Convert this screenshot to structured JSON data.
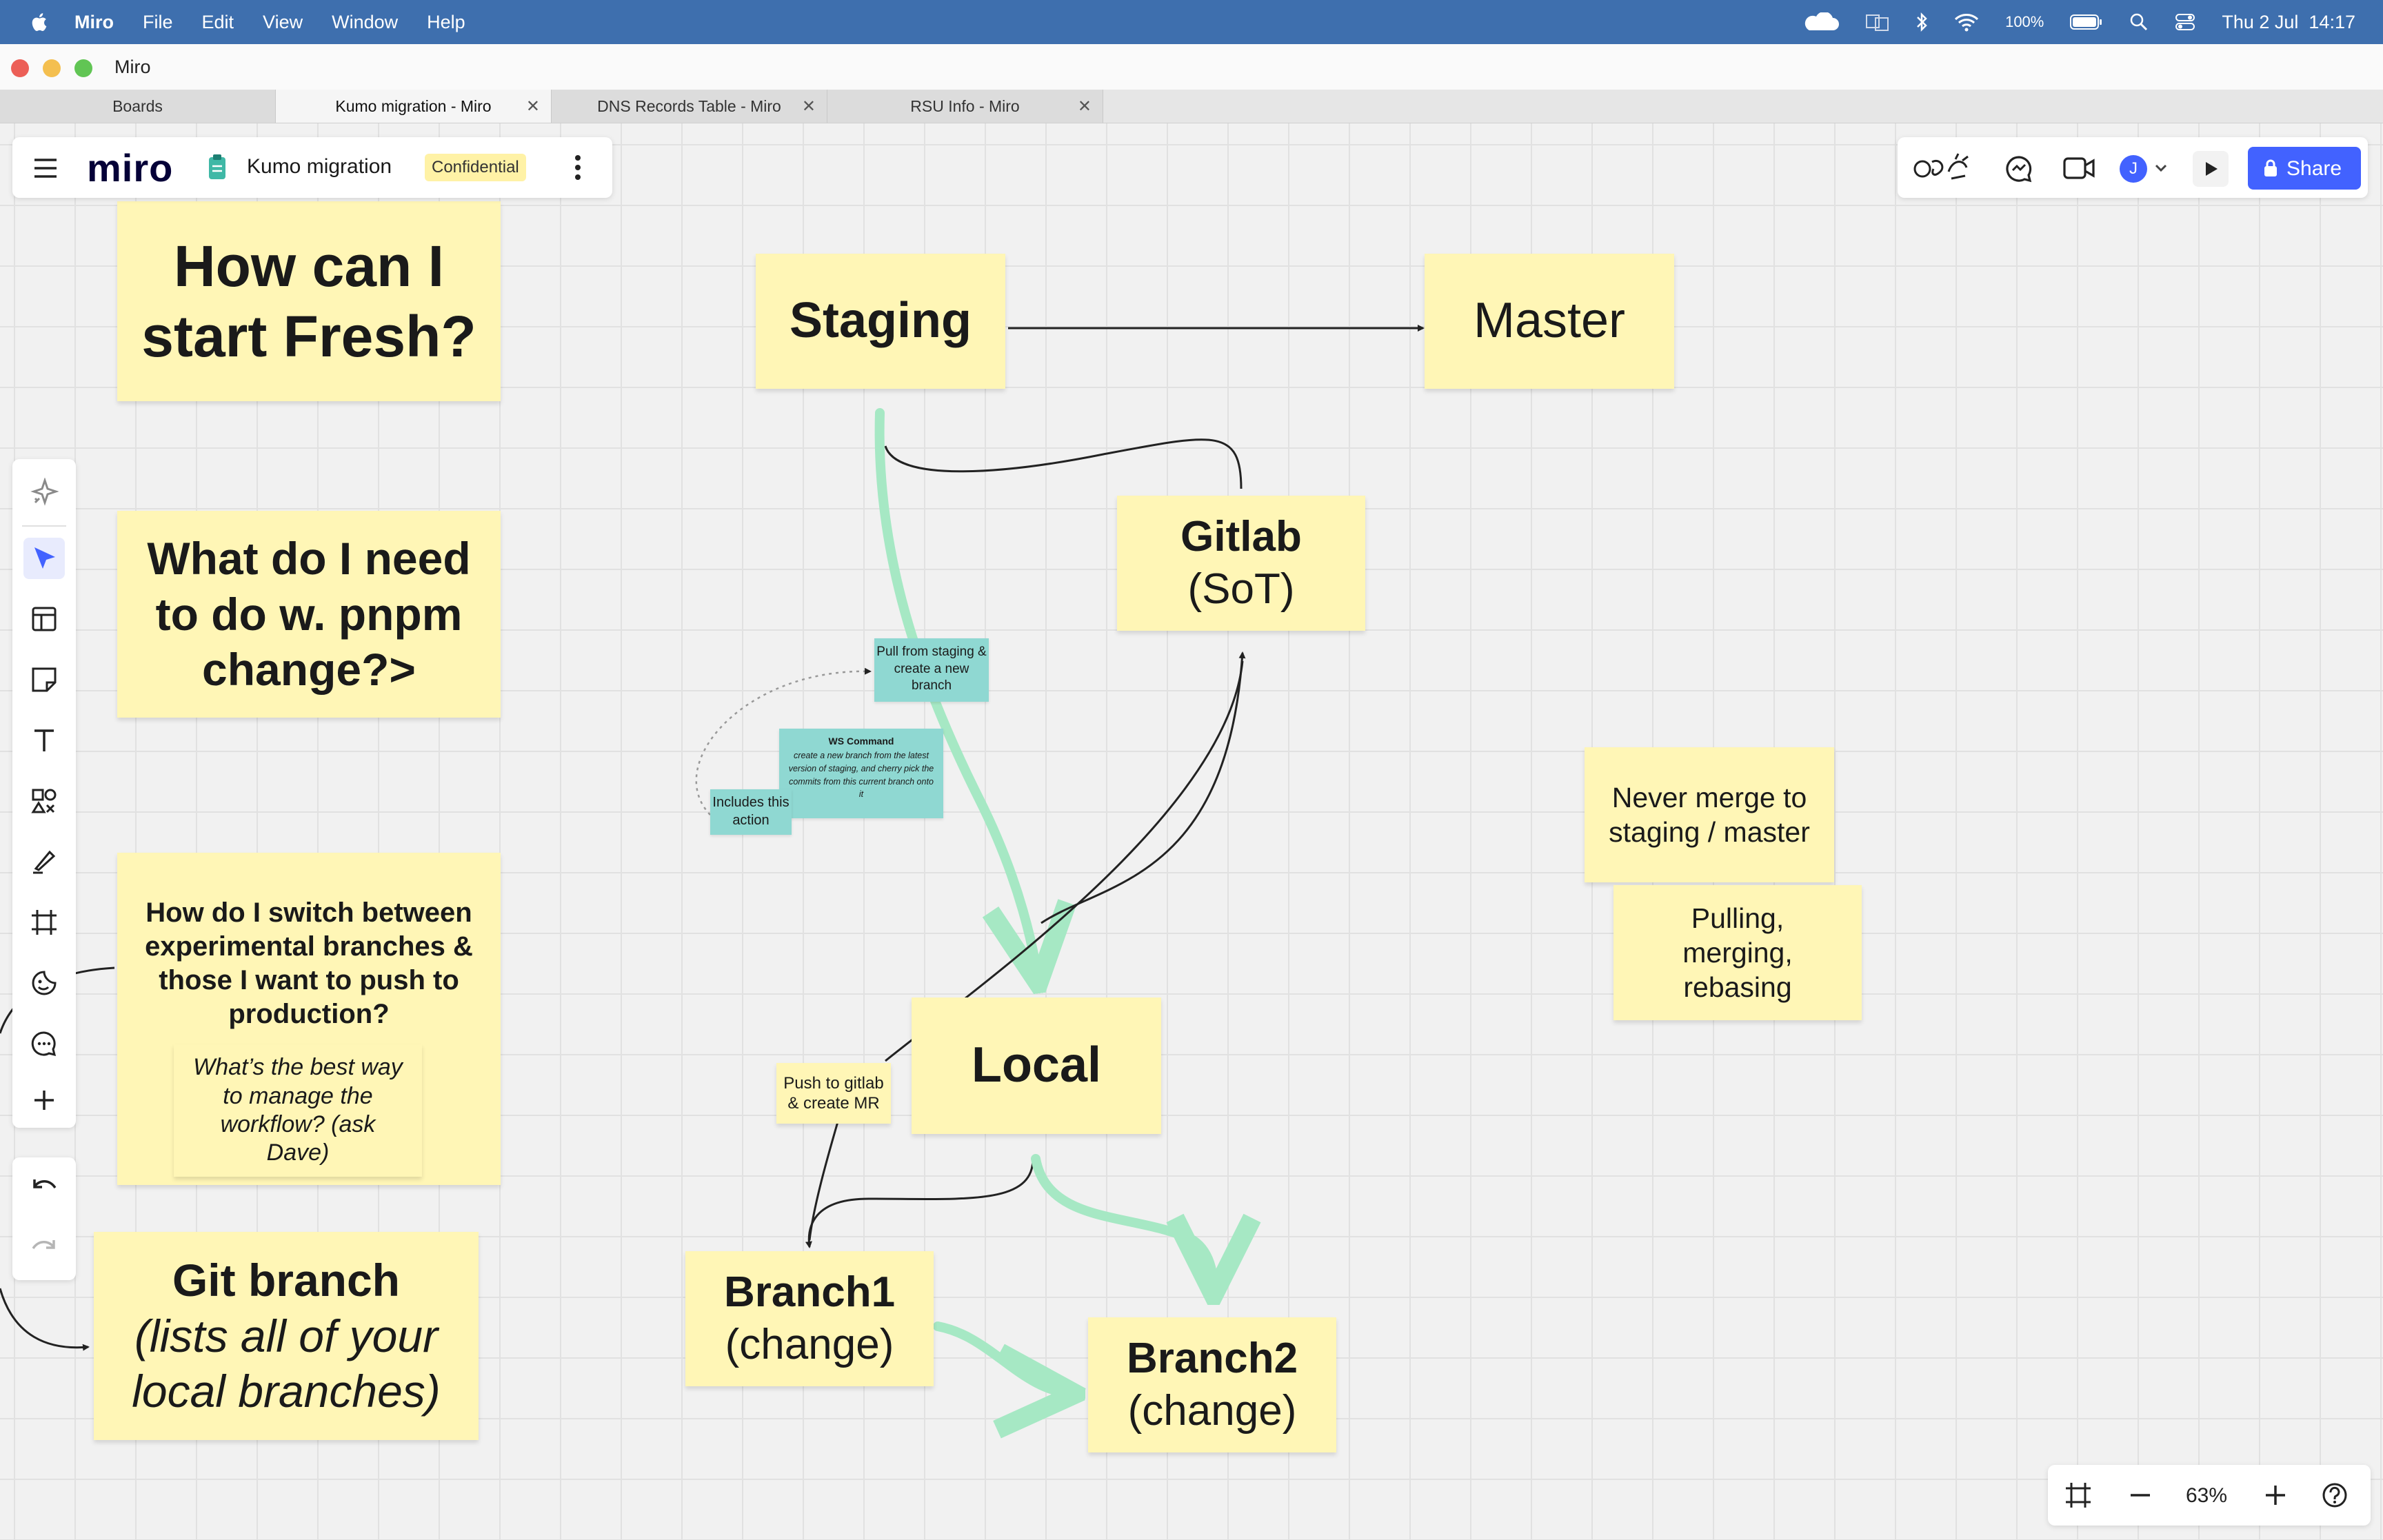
{
  "menubar": {
    "items": [
      "Miro",
      "File",
      "Edit",
      "View",
      "Window",
      "Help"
    ],
    "battery": "100%",
    "datetime": "Thu 2 Jul  14:17"
  },
  "window": {
    "title": "Miro"
  },
  "tabs": [
    {
      "label": "Boards"
    },
    {
      "label": "Kumo migration - Miro"
    },
    {
      "label": "DNS Records Table - Miro"
    },
    {
      "label": "RSU Info - Miro"
    }
  ],
  "board": {
    "logo": "miro",
    "name": "Kumo migration",
    "badge": "Confidential"
  },
  "top_right": {
    "share_label": "Share",
    "avatar_initial": "J"
  },
  "zoom": {
    "level": "63%"
  },
  "stickies": {
    "fresh": "How can I start Fresh?",
    "pnpm": "What do I need to do w. pnpm change?>",
    "switch": "How do I switch between experimental branches & those I want to push to production?",
    "workflow": "What’s the best way to manage the workflow? (ask Dave)",
    "gitbranch_title": "Git branch",
    "gitbranch_sub": "(lists all of your local branches)",
    "staging": "Staging",
    "master": "Master",
    "gitlab_title": "Gitlab",
    "gitlab_sub": "(SoT)",
    "local": "Local",
    "push": "Push to gitlab & create MR",
    "branch1_title": "Branch1",
    "branch1_sub": "(change)",
    "branch2_title": "Branch2",
    "branch2_sub": "(change)",
    "never": "Never merge to staging / master",
    "pulling": "Pulling, merging, rebasing"
  },
  "cyan_notes": {
    "pull": "Pull from staging & create a new branch",
    "ws_title": "WS Command",
    "ws_body": "create a new branch from the latest version of staging, and cherry pick the commits from this current branch onto it",
    "includes": "Includes this action"
  },
  "colors": {
    "sticky": "#fff6b6",
    "cyan_note": "#8fd8d2",
    "green_arrow": "#a6e8c4",
    "accent_blue": "#4262ff",
    "menubar": "#3e6fae"
  },
  "icons": {
    "left_toolbar": [
      "sparkle-icon",
      "select-icon",
      "templates-icon",
      "sticky-note-icon",
      "text-icon",
      "shapes-icon",
      "pen-icon",
      "frame-icon",
      "stickers-icon",
      "comment-icon",
      "plus-icon"
    ],
    "history": [
      "undo-icon",
      "redo-icon"
    ]
  }
}
